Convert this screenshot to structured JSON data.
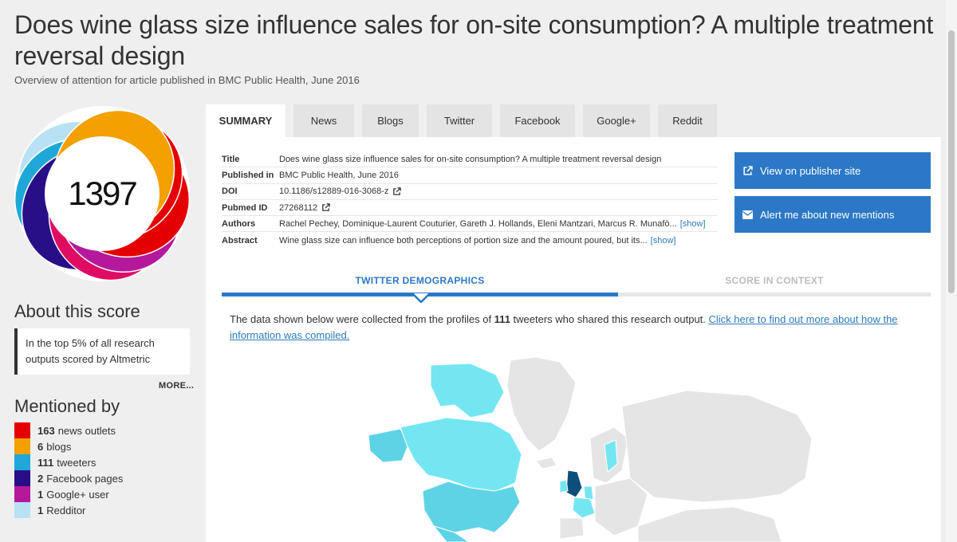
{
  "article": {
    "title": "Does wine glass size influence sales for on-site consumption? A multiple treatment reversal design",
    "subtitle": "Overview of attention for article published in BMC Public Health, June 2016"
  },
  "score": "1397",
  "donut_colors": [
    "#e40000",
    "#f3a000",
    "#1fa8d7",
    "#280f87",
    "#b5199b",
    "#b8e2f4",
    "#e00c64"
  ],
  "tabs": [
    "SUMMARY",
    "News",
    "Blogs",
    "Twitter",
    "Facebook",
    "Google+",
    "Reddit"
  ],
  "details": [
    {
      "label": "Title",
      "value": "Does wine glass size influence sales for on-site consumption? A multiple treatment reversal design"
    },
    {
      "label": "Published in",
      "value": "BMC Public Health, June 2016"
    },
    {
      "label": "DOI",
      "value": "10.1186/s12889-016-3068-z"
    },
    {
      "label": "Pubmed ID",
      "value": "27268112"
    },
    {
      "label": "Authors",
      "value": "Rachel Pechey, Dominique-Laurent Couturier, Gareth J. Hollands, Eleni Mantzari, Marcus R. Munafò...",
      "more": "[show]"
    },
    {
      "label": "Abstract",
      "value": "Wine glass size can influence both perceptions of portion size and the amount poured, but its...",
      "more": "[show]"
    }
  ],
  "actions": {
    "publisher": "View on publisher site",
    "alert": "Alert me about new mentions"
  },
  "sections": {
    "active": "TWITTER DEMOGRAPHICS",
    "inactive": "SCORE IN CONTEXT"
  },
  "intro": {
    "before": "The data shown below were collected from the profiles of ",
    "count": "111",
    "after": " tweeters who shared this research output. ",
    "link": "Click here to find out more about how the information was compiled."
  },
  "about": {
    "heading": "About this score",
    "text": "In the top 5% of all research outputs scored by Altmetric",
    "more": "MORE..."
  },
  "mentioned": {
    "heading": "Mentioned by",
    "items": [
      {
        "count": "163",
        "label": "news outlets",
        "color": "#e40000"
      },
      {
        "count": "6",
        "label": "blogs",
        "color": "#f3a000"
      },
      {
        "count": "111",
        "label": "tweeters",
        "color": "#1fa8d7"
      },
      {
        "count": "2",
        "label": "Facebook pages",
        "color": "#280f87"
      },
      {
        "count": "1",
        "label": "Google+ user",
        "color": "#b5199b"
      },
      {
        "count": "1",
        "label": "Redditor",
        "color": "#b8e2f4"
      }
    ]
  },
  "map_colors": {
    "land": "#e5e5e5",
    "border": "#ffffff",
    "light": "#74e6f2",
    "medium": "#5fd3e6",
    "dark": "#0b4f7a",
    "mid_blue": "#2f9fd4"
  }
}
